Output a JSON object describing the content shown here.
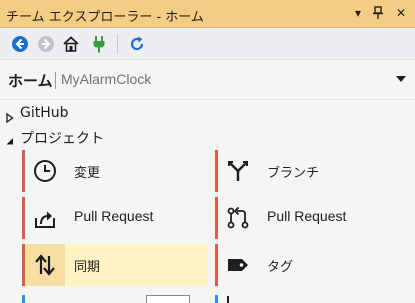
{
  "window": {
    "title": "チーム エクスプローラー - ホーム",
    "buttons": {
      "dropdown": "▾",
      "pin": "Ψ",
      "close": "✕"
    }
  },
  "toolbar": {
    "icons": [
      "back-icon",
      "forward-icon",
      "home-icon",
      "connect-plug-icon",
      "refresh-icon"
    ]
  },
  "header": {
    "title": "ホーム",
    "repository": "MyAlarmClock"
  },
  "sections": {
    "github": {
      "label": "GitHub",
      "expanded": false
    },
    "project": {
      "label": "プロジェクト",
      "expanded": true
    }
  },
  "tiles": [
    {
      "label": "変更",
      "icon": "clock-icon",
      "accent": "#e05a47"
    },
    {
      "label": "ブランチ",
      "icon": "branch-icon",
      "accent": "#e05a47"
    },
    {
      "label": "Pull Request",
      "icon": "share-upload-icon",
      "accent": "#e05a47"
    },
    {
      "label": "Pull Request",
      "icon": "pull-request-icon",
      "accent": "#e05a47"
    },
    {
      "label": "同期",
      "icon": "sync-arrows-icon",
      "accent": "#e05a47",
      "selected": true
    },
    {
      "label": "タグ",
      "icon": "tag-icon",
      "accent": "#e05a47"
    }
  ],
  "colors": {
    "titlebar": "#f5cc84",
    "toolbar": "#eeeef2",
    "accent_orange": "#e05a47",
    "accent_blue": "#1c97ea",
    "selected_tile": "#fff4c4",
    "selected_icon_box": "#f7dfa3",
    "plug_green": "#3c9b3a"
  }
}
